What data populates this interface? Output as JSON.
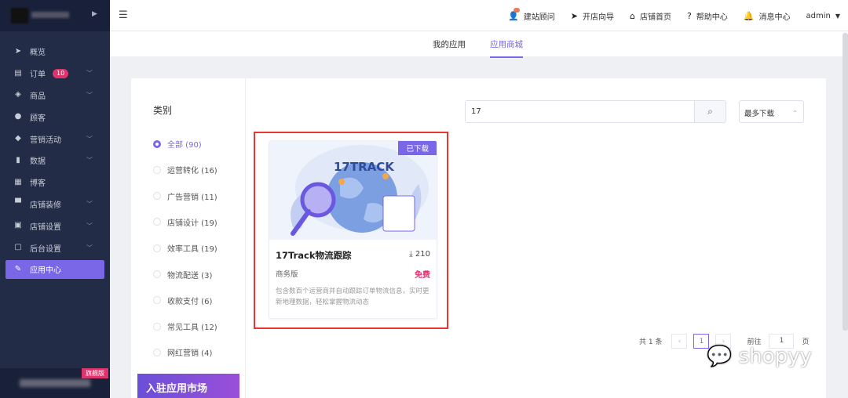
{
  "sidebar": {
    "badge_edition": "旗舰版",
    "items": [
      {
        "label": "概览",
        "icon": "navigation-icon"
      },
      {
        "label": "订单",
        "icon": "clipboard-icon",
        "badge": "10",
        "expand": true
      },
      {
        "label": "商品",
        "icon": "box-icon",
        "expand": true
      },
      {
        "label": "顾客",
        "icon": "user-icon"
      },
      {
        "label": "营销活动",
        "icon": "tag-icon",
        "expand": true
      },
      {
        "label": "数据",
        "icon": "bar-chart-icon",
        "expand": true
      },
      {
        "label": "博客",
        "icon": "blog-icon"
      },
      {
        "label": "店铺装修",
        "icon": "paint-roller-icon",
        "expand": true
      },
      {
        "label": "店铺设置",
        "icon": "store-icon",
        "expand": true
      },
      {
        "label": "后台设置",
        "icon": "monitor-icon",
        "expand": true
      },
      {
        "label": "应用中心",
        "icon": "wrench-icon",
        "active": true
      }
    ]
  },
  "header": {
    "nav": [
      {
        "label": "建站顾问"
      },
      {
        "label": "开店向导"
      },
      {
        "label": "店铺首页"
      },
      {
        "label": "帮助中心"
      },
      {
        "label": "消息中心"
      }
    ],
    "user": "admin"
  },
  "tabs": [
    {
      "label": "我的应用"
    },
    {
      "label": "应用商城",
      "selected": true
    }
  ],
  "categories": {
    "title": "类别",
    "items": [
      {
        "label": "全部 (90)",
        "selected": true
      },
      {
        "label": "运营转化 (16)"
      },
      {
        "label": "广告营销 (11)"
      },
      {
        "label": "店铺设计 (19)"
      },
      {
        "label": "效率工具 (19)"
      },
      {
        "label": "物流配送 (3)"
      },
      {
        "label": "收款支付 (6)"
      },
      {
        "label": "常见工具 (12)"
      },
      {
        "label": "网红营销 (4)"
      }
    ],
    "join_banner": "入驻应用市场"
  },
  "search": {
    "value": "17",
    "sort": "最多下载"
  },
  "apps": [
    {
      "name": "17Track物流跟踪",
      "downloads": "210",
      "edition": "商务版",
      "price": "免费",
      "status": "已下载",
      "logo_text": "17TRACK",
      "description": "包含数百个运营商并自动跟踪订单物流信息，实时更新地理数据，轻松掌握物流动态"
    }
  ],
  "pagination": {
    "total": "共 1 条",
    "current": "1",
    "goto_label": "前往",
    "goto_value": "1",
    "page_suffix": "页"
  },
  "watermark": "shopyy"
}
